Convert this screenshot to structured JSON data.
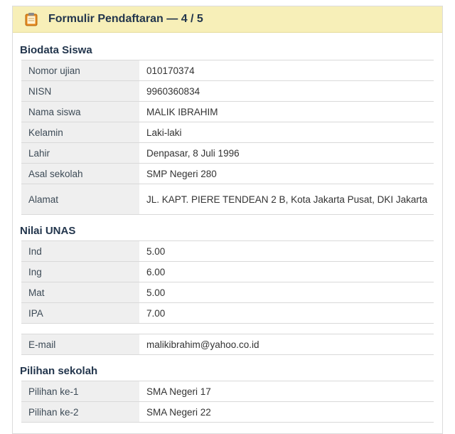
{
  "header": {
    "title": "Formulir Pendaftaran — 4 / 5"
  },
  "biodata": {
    "title": "Biodata Siswa",
    "rows": [
      {
        "label": "Nomor ujian",
        "value": "010170374"
      },
      {
        "label": "NISN",
        "value": "9960360834"
      },
      {
        "label": "Nama siswa",
        "value": "MALIK IBRAHIM"
      },
      {
        "label": "Kelamin",
        "value": "Laki-laki"
      },
      {
        "label": "Lahir",
        "value": "Denpasar, 8 Juli 1996"
      },
      {
        "label": "Asal sekolah",
        "value": "SMP Negeri 280"
      },
      {
        "label": "Alamat",
        "value": "JL. KAPT. PIERE TENDEAN 2 B, Kota Jakarta Pusat, DKI Jakarta"
      }
    ]
  },
  "nilai": {
    "title": "Nilai UNAS",
    "rows": [
      {
        "label": "Ind",
        "value": "5.00"
      },
      {
        "label": "Ing",
        "value": "6.00"
      },
      {
        "label": "Mat",
        "value": "5.00"
      },
      {
        "label": "IPA",
        "value": "7.00"
      }
    ]
  },
  "contact": {
    "rows": [
      {
        "label": "E-mail",
        "value": "malikibrahim@yahoo.co.id"
      }
    ]
  },
  "pilihan": {
    "title": "Pilihan sekolah",
    "rows": [
      {
        "label": "Pilihan ke-1",
        "value": "SMA Negeri 17"
      },
      {
        "label": "Pilihan ke-2",
        "value": "SMA Negeri 22"
      }
    ]
  },
  "icons": {
    "header_icon": "clipboard-icon"
  },
  "colors": {
    "header_bg": "#f7efb8",
    "label_bg": "#efefef",
    "title_text": "#23364d"
  }
}
